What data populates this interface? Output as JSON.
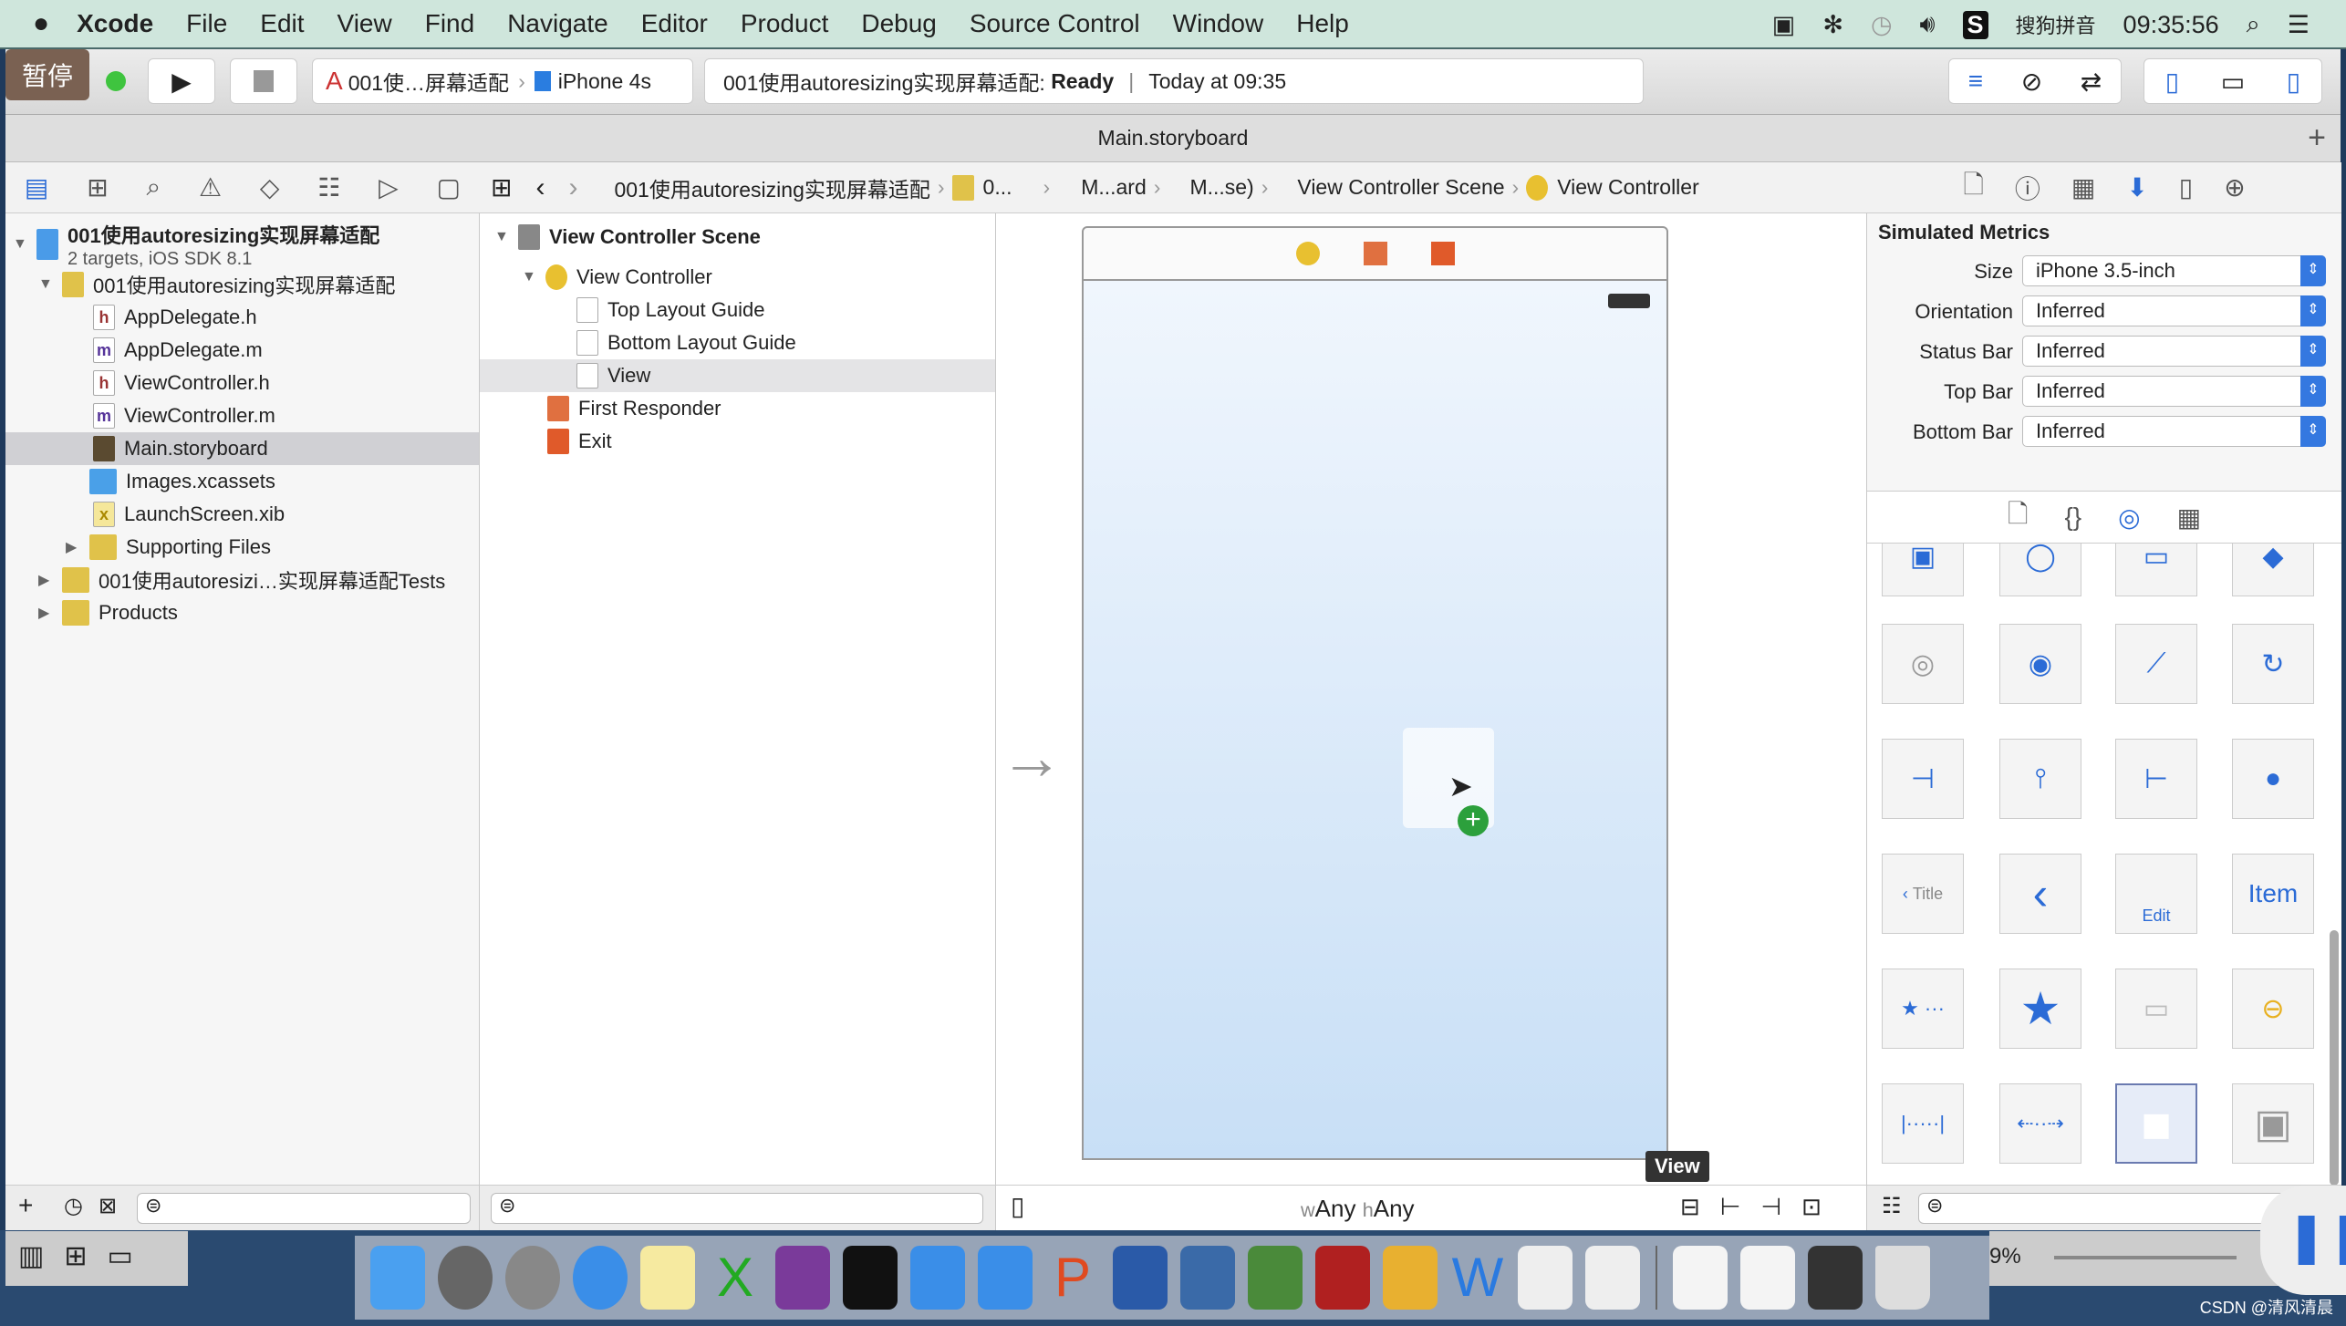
{
  "menubar": {
    "app": "Xcode",
    "items": [
      "File",
      "Edit",
      "View",
      "Find",
      "Navigate",
      "Editor",
      "Product",
      "Debug",
      "Source Control",
      "Window",
      "Help"
    ],
    "input_method": "搜狗拼音",
    "clock": "09:35:56"
  },
  "toolbar": {
    "pause_label": "暂停",
    "scheme": "001使…屏幕适配",
    "device": "iPhone 4s",
    "activity_project": "001使用autoresizing实现屏幕适配:",
    "activity_status": "Ready",
    "activity_time": "Today at 09:35"
  },
  "tab": {
    "title": "Main.storyboard"
  },
  "jumpbar": [
    "001使用autoresizing实现屏幕适配",
    "0...",
    "M...ard",
    "M...se)",
    "View Controller Scene",
    "View Controller"
  ],
  "navigator": {
    "project": "001使用autoresizing实现屏幕适配",
    "project_sub": "2 targets, iOS SDK 8.1",
    "group": "001使用autoresizing实现屏幕适配",
    "files": [
      {
        "type": "h",
        "name": "AppDelegate.h"
      },
      {
        "type": "m",
        "name": "AppDelegate.m"
      },
      {
        "type": "h",
        "name": "ViewController.h"
      },
      {
        "type": "m",
        "name": "ViewController.m"
      },
      {
        "type": "sb",
        "name": "Main.storyboard",
        "selected": true
      },
      {
        "type": "xc",
        "name": "Images.xcassets"
      },
      {
        "type": "xib",
        "name": "LaunchScreen.xib"
      }
    ],
    "supporting": "Supporting Files",
    "tests": "001使用autoresizi…实现屏幕适配Tests",
    "products": "Products"
  },
  "outline": {
    "scene": "View Controller Scene",
    "vc": "View Controller",
    "top_guide": "Top Layout Guide",
    "bottom_guide": "Bottom Layout Guide",
    "view": "View",
    "first_responder": "First Responder",
    "exit": "Exit"
  },
  "canvas": {
    "size_w": "Any",
    "size_h": "Any",
    "tooltip": "View"
  },
  "inspector": {
    "section": "Simulated Metrics",
    "fields": [
      {
        "label": "Size",
        "value": "iPhone 3.5-inch"
      },
      {
        "label": "Orientation",
        "value": "Inferred"
      },
      {
        "label": "Status Bar",
        "value": "Inferred"
      },
      {
        "label": "Top Bar",
        "value": "Inferred"
      },
      {
        "label": "Bottom Bar",
        "value": "Inferred"
      }
    ]
  },
  "library": {
    "labels": {
      "title": "Title",
      "edit": "Edit",
      "item": "Item"
    }
  },
  "dock": {
    "zoom_partial": "9%"
  },
  "watermark": "CSDN @清风清晨",
  "colors": {
    "accent": "#3478e0",
    "pause_bg": "#7a6152",
    "canvas_view": "#d4e6f8"
  }
}
